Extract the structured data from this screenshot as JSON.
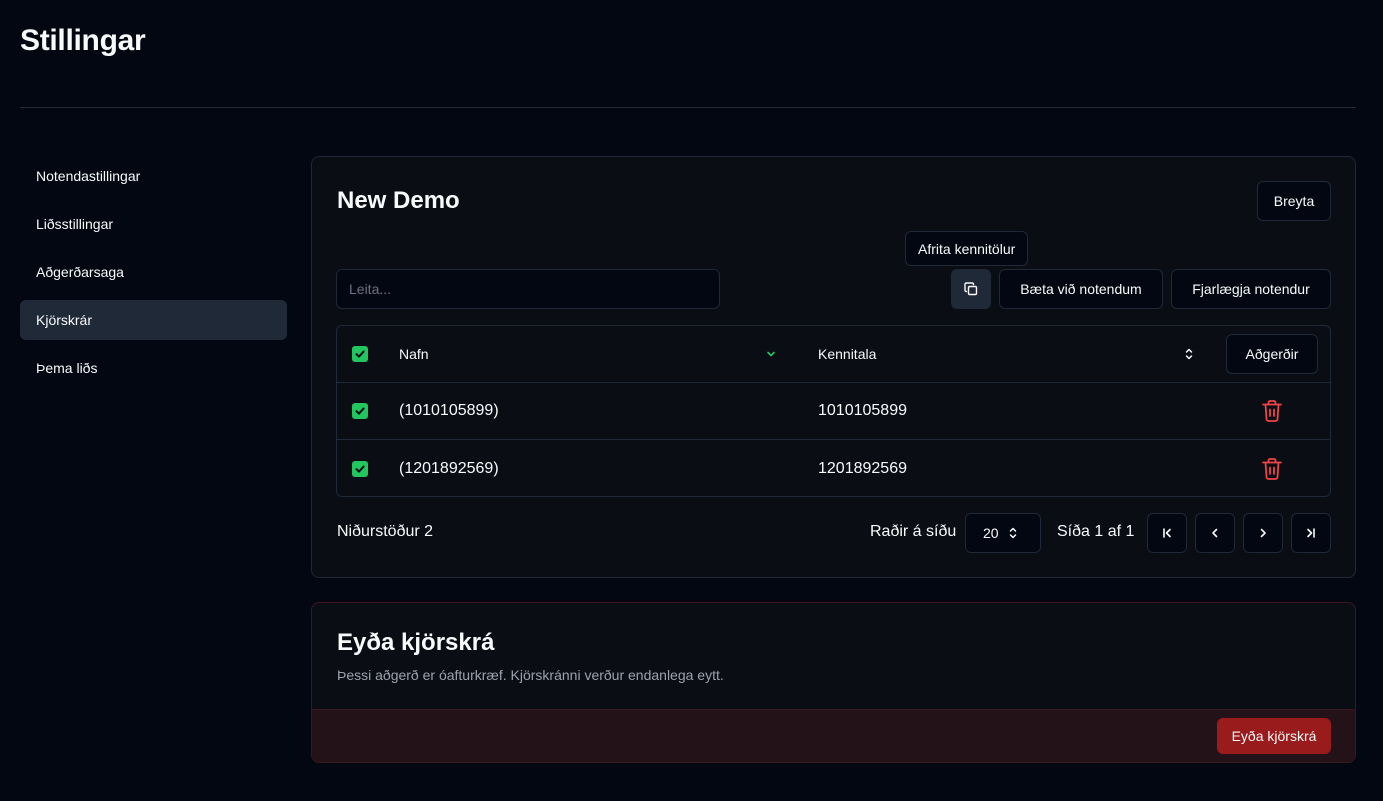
{
  "page": {
    "title": "Stillingar"
  },
  "sidebar": {
    "items": [
      {
        "label": "Notendastillingar"
      },
      {
        "label": "Liðsstillingar"
      },
      {
        "label": "Aðgerðarsaga"
      },
      {
        "label": "Kjörskrár",
        "active": true
      },
      {
        "label": "Þema liðs"
      }
    ]
  },
  "list": {
    "title": "New Demo",
    "edit_label": "Breyta",
    "copy_tooltip": "Afrita kennitölur",
    "search_placeholder": "Leita...",
    "add_label": "Bæta við notendum",
    "remove_label": "Fjarlægja notendur",
    "table": {
      "columns": {
        "name": "Nafn",
        "kennitala": "Kennitala",
        "actions": "Aðgerðir"
      },
      "rows": [
        {
          "name": "(1010105899)",
          "kennitala": "1010105899",
          "selected": true
        },
        {
          "name": "(1201892569)",
          "kennitala": "1201892569",
          "selected": true
        }
      ]
    },
    "footer": {
      "results": "Niðurstöður 2",
      "rows_per_page_label": "Raðir á síðu",
      "rows_per_page": "20",
      "page_info": "Síða 1 af 1"
    }
  },
  "danger": {
    "title": "Eyða kjörskrá",
    "description": "Þessi aðgerð er óafturkræf. Kjörskránni verður endanlega eytt.",
    "delete_label": "Eyða kjörskrá"
  },
  "colors": {
    "background": "#030712",
    "border": "#1f2937",
    "checkbox": "#22c55e",
    "trash": "#ef4444",
    "danger_button": "#991b1b"
  },
  "icons": {
    "copy": "copy-icon",
    "sort_name": "chevron-down-icon",
    "sort_kennitala": "chevrons-up-down-icon",
    "row_delete": "trash-icon",
    "page_first": "chevrons-left-bar-icon",
    "page_prev": "chevron-left-icon",
    "page_next": "chevron-right-icon",
    "page_last": "chevrons-right-bar-icon"
  }
}
